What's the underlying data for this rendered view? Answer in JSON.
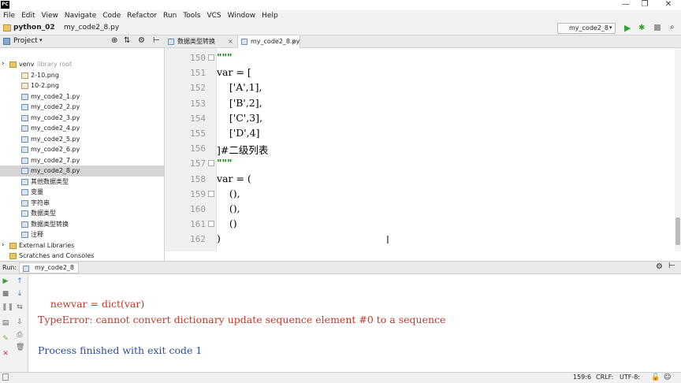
{
  "window": {
    "logo": "PC",
    "controls": [
      "—",
      "❐",
      "✕"
    ]
  },
  "menu": [
    "File",
    "Edit",
    "View",
    "Navigate",
    "Code",
    "Refactor",
    "Run",
    "Tools",
    "VCS",
    "Window",
    "Help"
  ],
  "navbar": {
    "breadcrumb_project": "python_02",
    "breadcrumb_file": "my_code2_8.py",
    "run_config": "my_code2_8"
  },
  "project_panel": {
    "title": "Project",
    "tree": [
      {
        "label": "venv",
        "suffix": "library root",
        "type": "folder",
        "indent": 0,
        "expander": "›"
      },
      {
        "label": "2-10.png",
        "type": "png",
        "indent": 1
      },
      {
        "label": "10-2.png",
        "type": "png",
        "indent": 1
      },
      {
        "label": "my_code2_1.py",
        "type": "py",
        "indent": 1
      },
      {
        "label": "my_code2_2.py",
        "type": "py",
        "indent": 1
      },
      {
        "label": "my_code2_3.py",
        "type": "py",
        "indent": 1
      },
      {
        "label": "my_code2_4.py",
        "type": "py",
        "indent": 1
      },
      {
        "label": "my_code2_5.py",
        "type": "py",
        "indent": 1
      },
      {
        "label": "my_code2_6.py",
        "type": "py",
        "indent": 1
      },
      {
        "label": "my_code2_7.py",
        "type": "py",
        "indent": 1
      },
      {
        "label": "my_code2_8.py",
        "type": "py",
        "indent": 1,
        "selected": true
      },
      {
        "label": "其他数据类型",
        "type": "py",
        "indent": 1
      },
      {
        "label": "变量",
        "type": "py",
        "indent": 1
      },
      {
        "label": "字符串",
        "type": "py",
        "indent": 1
      },
      {
        "label": "数据类型",
        "type": "py",
        "indent": 1
      },
      {
        "label": "数据类型转换",
        "type": "py",
        "indent": 1
      },
      {
        "label": "注释",
        "type": "py",
        "indent": 1
      },
      {
        "label": "External Libraries",
        "type": "lib",
        "indent": 0,
        "expander": "›"
      },
      {
        "label": "Scratches and Consoles",
        "type": "scratch",
        "indent": 0
      }
    ]
  },
  "tabs": [
    {
      "label": "数据类型转换",
      "close": "×",
      "active": false
    },
    {
      "label": "my_code2_8.py",
      "close": "×",
      "active": true
    }
  ],
  "editor": {
    "lines": [
      {
        "n": "150",
        "text": "\"\"\""
      },
      {
        "n": "151",
        "text": "var = ["
      },
      {
        "n": "152",
        "text": "    ['A',1],"
      },
      {
        "n": "153",
        "text": "    ['B',2],"
      },
      {
        "n": "154",
        "text": "    ['C',3],"
      },
      {
        "n": "155",
        "text": "    ['D',4]"
      },
      {
        "n": "156",
        "text": "]#二级列表"
      },
      {
        "n": "157",
        "text": "\"\"\""
      },
      {
        "n": "158",
        "text": "var = ("
      },
      {
        "n": "159",
        "text": "    (),"
      },
      {
        "n": "160",
        "text": "    (),"
      },
      {
        "n": "161",
        "text": "    ()"
      },
      {
        "n": "162",
        "text": ")"
      }
    ],
    "current_line": "159"
  },
  "run_panel": {
    "label": "Run:",
    "tab": "my_code2_8",
    "output": [
      {
        "text": "    newvar = dict(var)",
        "kind": "code"
      },
      {
        "text": "TypeError: cannot convert dictionary update sequence element #0 to a sequence",
        "kind": "error"
      },
      {
        "text": "",
        "kind": "blank"
      },
      {
        "text": "Process finished with exit code 1",
        "kind": "info"
      }
    ]
  },
  "status": {
    "position": "159:6",
    "line_sep": "CRLF:",
    "encoding": "UTF-8:"
  }
}
